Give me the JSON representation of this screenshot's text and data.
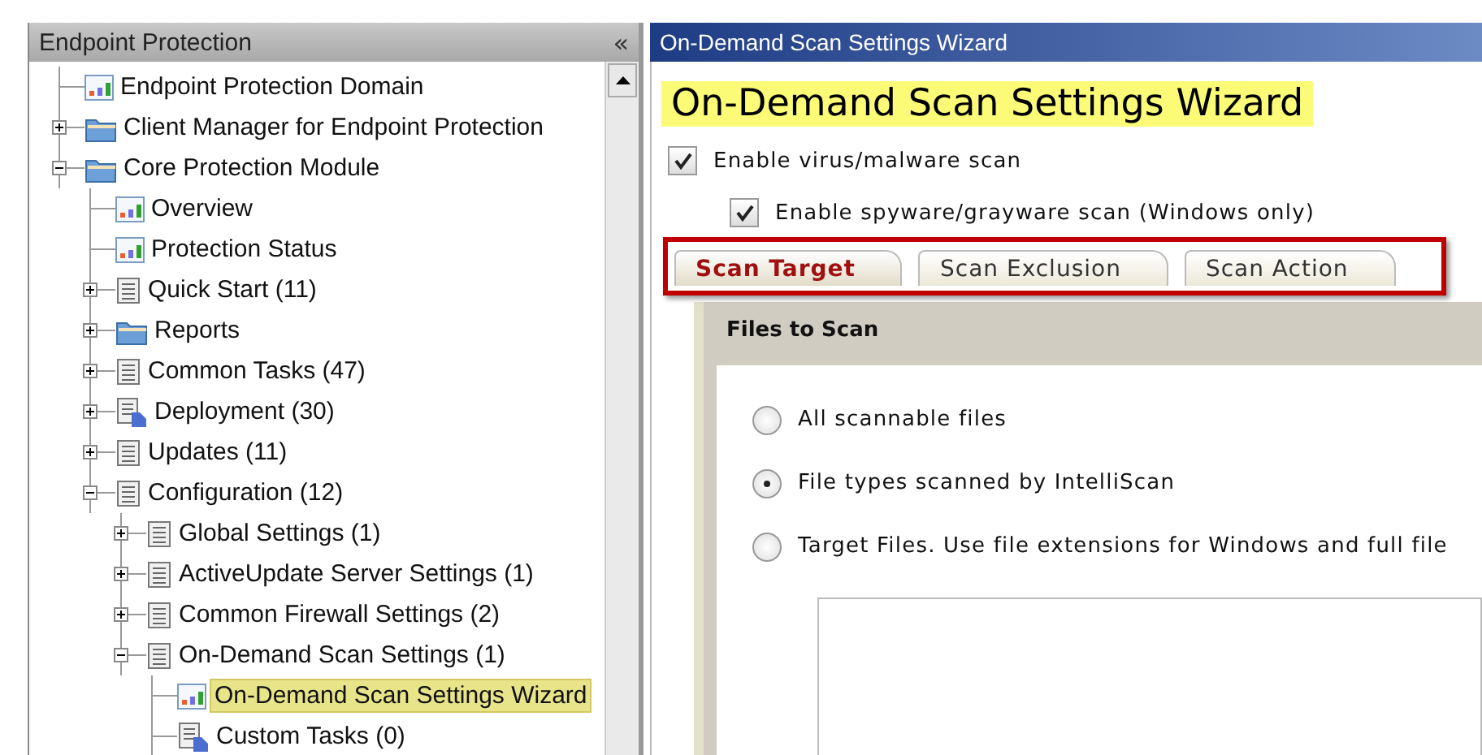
{
  "sidebar": {
    "title": "Endpoint Protection",
    "collapse_button": "«",
    "tree": [
      {
        "label": "Endpoint Protection Domain",
        "kind": "chart",
        "selected": false
      },
      {
        "label": "Client Manager for Endpoint Protection",
        "kind": "folder",
        "expanded": false,
        "selected": false
      },
      {
        "label": "Core Protection Module",
        "kind": "folder",
        "expanded": true,
        "selected": false,
        "children": [
          {
            "label": "Overview",
            "kind": "chart",
            "selected": false
          },
          {
            "label": "Protection Status",
            "kind": "chart",
            "selected": false
          },
          {
            "label": "Quick Start (11)",
            "kind": "list",
            "expanded": false,
            "selected": false
          },
          {
            "label": "Reports",
            "kind": "folder",
            "expanded": false,
            "selected": false
          },
          {
            "label": "Common Tasks (47)",
            "kind": "list",
            "expanded": false,
            "selected": false
          },
          {
            "label": "Deployment (30)",
            "kind": "tasks",
            "expanded": false,
            "selected": false
          },
          {
            "label": "Updates (11)",
            "kind": "list",
            "expanded": false,
            "selected": false
          },
          {
            "label": "Configuration (12)",
            "kind": "list",
            "expanded": true,
            "selected": false,
            "children": [
              {
                "label": "Global Settings (1)",
                "kind": "list",
                "expanded": false,
                "selected": false
              },
              {
                "label": "ActiveUpdate Server Settings (1)",
                "kind": "list",
                "expanded": false,
                "selected": false
              },
              {
                "label": "Common Firewall Settings (2)",
                "kind": "list",
                "expanded": false,
                "selected": false
              },
              {
                "label": "On-Demand Scan Settings (1)",
                "kind": "list",
                "expanded": true,
                "selected": false,
                "children": [
                  {
                    "label": "On-Demand Scan Settings Wizard",
                    "kind": "chart",
                    "selected": true
                  },
                  {
                    "label": "Custom Tasks (0)",
                    "kind": "tasks",
                    "selected": false
                  }
                ]
              }
            ]
          }
        ]
      }
    ]
  },
  "main": {
    "title": "On-Demand Scan Settings Wizard",
    "heading": "On-Demand Scan Settings Wizard",
    "options": [
      {
        "label": "Enable virus/malware scan",
        "checked": true
      },
      {
        "label": "Enable spyware/grayware scan (Windows only)",
        "checked": true
      }
    ],
    "tabs": [
      {
        "label": "Scan Target",
        "selected": true
      },
      {
        "label": "Scan Exclusion",
        "selected": false
      },
      {
        "label": "Scan Action",
        "selected": false
      }
    ],
    "section": {
      "title": "Files to Scan",
      "radios": [
        {
          "label": "All scannable files",
          "selected": false
        },
        {
          "label": "File types scanned by IntelliScan",
          "selected": true
        },
        {
          "label": "Target Files. Use file extensions for Windows and full file",
          "selected": false
        }
      ]
    }
  }
}
